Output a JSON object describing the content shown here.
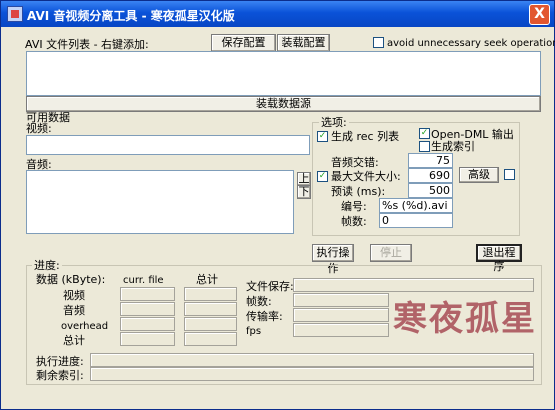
{
  "window": {
    "title": "AVI 音视频分离工具 - 寒夜孤星汉化版",
    "close_glyph": "X"
  },
  "file_list": {
    "label": "AVI 文件列表 - 右键添加:",
    "save_config": "保存配置",
    "load_config": "装载配置",
    "avoid_seek": {
      "label": "avoid unnecessary seek operations",
      "checked": false
    },
    "load_source": "装载数据源"
  },
  "available_data": {
    "label": "可用数据",
    "video_label": "视频:",
    "audio_label": "音频:",
    "up": "上",
    "down": "下"
  },
  "options": {
    "label": "选项:",
    "gen_rec": {
      "label": "生成 rec 列表",
      "checked": true,
      "mark": "✓"
    },
    "opendml": {
      "label": "Open-DML 输出",
      "checked": true,
      "mark": "✓"
    },
    "gen_index": {
      "label": "生成索引",
      "checked": false
    },
    "interleave": {
      "label": "音频交错:",
      "value": "75"
    },
    "maxsize": {
      "label": "最大文件大小:",
      "checked": true,
      "mark": "✓",
      "value": "690"
    },
    "preload": {
      "label": "预读 (ms):",
      "value": "500"
    },
    "advanced": "高级",
    "naming": {
      "label": "编号:",
      "value": "%s (%d).avi"
    },
    "frames": {
      "label": "帧数:",
      "value": "0"
    }
  },
  "actions": {
    "execute": "执行操作",
    "stop": "停止",
    "exit": "退出程序"
  },
  "progress": {
    "label": "进度:",
    "data_header": "数据 (kByte):",
    "col_curr": "curr. file",
    "col_total": "总计",
    "rows": [
      "视频",
      "音频",
      "overhead",
      "总计"
    ],
    "file_save": "文件保存:",
    "frames": "帧数:",
    "rate": "传输率:",
    "fps": "fps",
    "exec_progress": "执行进度:",
    "remain_index": "剩余索引:"
  },
  "watermark": "寒夜孤星"
}
